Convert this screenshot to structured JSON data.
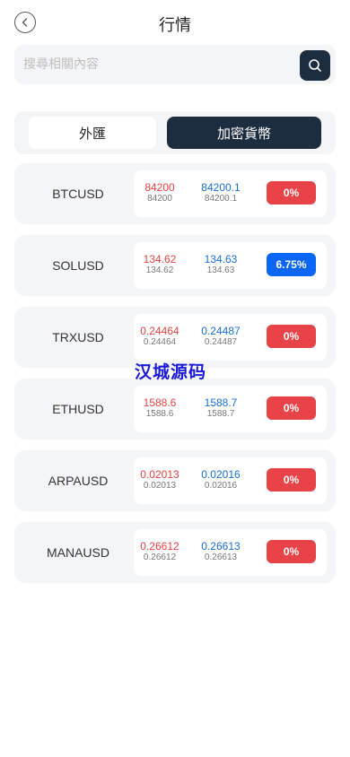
{
  "header": {
    "title": "行情"
  },
  "search": {
    "placeholder": "搜尋相關內容"
  },
  "tabs": [
    {
      "label": "外匯",
      "active": false
    },
    {
      "label": "加密貨幣",
      "active": true
    }
  ],
  "quotes": [
    {
      "symbol": "BTCUSD",
      "bid": "84200",
      "bid_sub": "84200",
      "ask": "84200.1",
      "ask_sub": "84200.1",
      "change": "0%"
    },
    {
      "symbol": "SOLUSD",
      "bid": "134.62",
      "bid_sub": "134.62",
      "ask": "134.63",
      "ask_sub": "134.63",
      "change": "6.75%"
    },
    {
      "symbol": "TRXUSD",
      "bid": "0.24464",
      "bid_sub": "0.24464",
      "ask": "0.24487",
      "ask_sub": "0.24487",
      "change": "0%"
    },
    {
      "symbol": "ETHUSD",
      "bid": "1588.6",
      "bid_sub": "1588.6",
      "ask": "1588.7",
      "ask_sub": "1588.7",
      "change": "0%"
    },
    {
      "symbol": "ARPAUSD",
      "bid": "0.02013",
      "bid_sub": "0.02013",
      "ask": "0.02016",
      "ask_sub": "0.02016",
      "change": "0%"
    },
    {
      "symbol": "MANAUSD",
      "bid": "0.26612",
      "bid_sub": "0.26612",
      "ask": "0.26613",
      "ask_sub": "0.26613",
      "change": "0%"
    }
  ],
  "watermark": "汉城源码",
  "colors": {
    "primary": "#1d2d40",
    "bid": "#e44343",
    "ask": "#1a6fd1",
    "badge_neutral": "#e9434a",
    "badge_up": "#0b66f5"
  },
  "icons": {
    "back": "chevron-left-icon",
    "search": "search-icon"
  }
}
